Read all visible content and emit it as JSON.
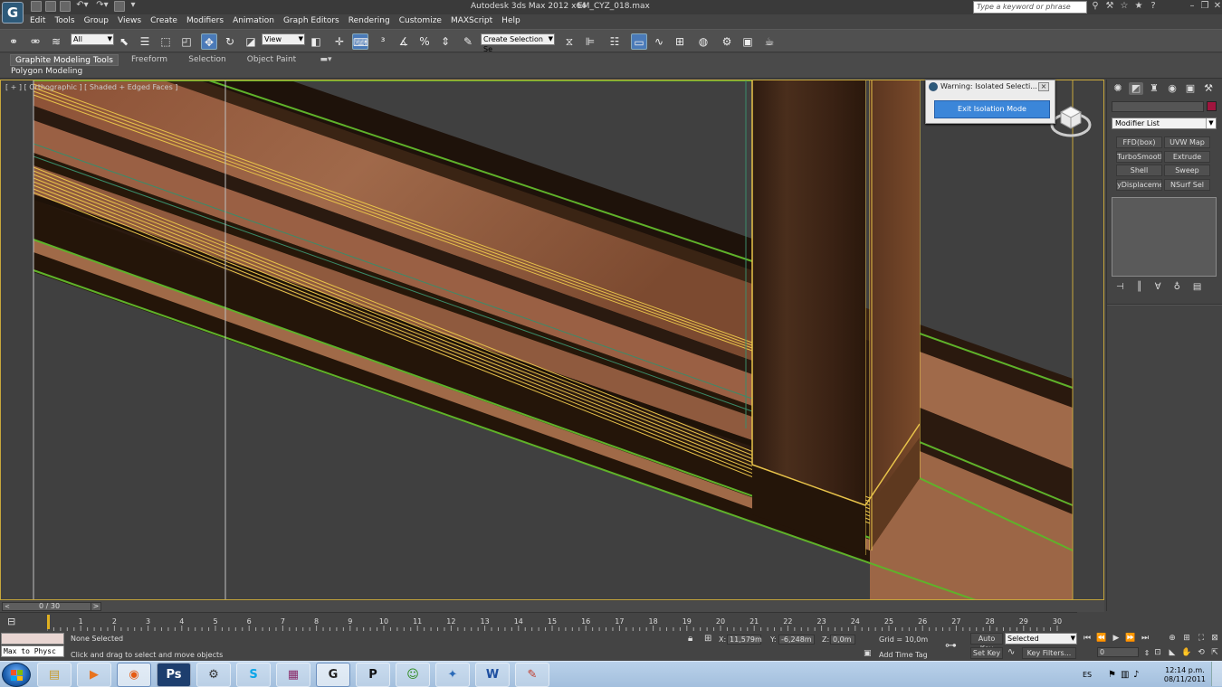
{
  "titlebar": {
    "app_title": "Autodesk 3ds Max  2012 x64",
    "file_name": "EM_CYZ_018.max",
    "search_placeholder": "Type a keyword or phrase",
    "logo_letter": "G"
  },
  "menu": [
    "Edit",
    "Tools",
    "Group",
    "Views",
    "Create",
    "Modifiers",
    "Animation",
    "Graph Editors",
    "Rendering",
    "Customize",
    "MAXScript",
    "Help"
  ],
  "toolbar": {
    "selection_filter": "All",
    "reference_coord": "View",
    "named_selection": "Create Selection Se"
  },
  "ribbon": {
    "tabs": [
      "Graphite Modeling Tools",
      "Freeform",
      "Selection",
      "Object Paint"
    ],
    "active_tab": "Graphite Modeling Tools",
    "sub_tab": "Polygon Modeling"
  },
  "viewport": {
    "label": "[ + ] [ Orthographic ] [ Shaded + Edged Faces ]"
  },
  "warning": {
    "title": "Warning: Isolated Selecti...",
    "close": "⨯",
    "button": "Exit Isolation Mode"
  },
  "command_panel": {
    "object_color": "#a0153e",
    "modifier_list": "Modifier List",
    "modifier_buttons": [
      "FFD(box)",
      "UVW Map",
      "TurboSmooth",
      "Extrude",
      "Shell",
      "Sweep",
      "yDisplacement",
      "NSurf Sel"
    ]
  },
  "timeline": {
    "frame_display": "0 / 30",
    "ticks": [
      "1",
      "2",
      "3",
      "4",
      "5",
      "6",
      "7",
      "8",
      "9",
      "10",
      "11",
      "12",
      "13",
      "14",
      "15",
      "16",
      "17",
      "18",
      "19",
      "20",
      "21",
      "22",
      "23",
      "24",
      "25",
      "26",
      "27",
      "28",
      "29",
      "30"
    ]
  },
  "status": {
    "maxscript_line": "Max to Physc",
    "selection_status": "None Selected",
    "prompt": "Click and drag to select and move objects",
    "x_label": "X:",
    "x_value": "11,579m",
    "y_label": "Y:",
    "y_value": "-6,248m",
    "z_label": "Z:",
    "z_value": "0,0m",
    "grid": "Grid = 10,0m",
    "add_time_tag": "Add Time Tag",
    "auto_key": "Auto Key",
    "auto_key_mode": "Selected",
    "set_key": "Set Key",
    "key_filters": "Key Filters...",
    "current_frame": "0"
  },
  "taskbar": {
    "language": "ES",
    "time": "12:14 p.m.",
    "date": "08/11/2011",
    "apps": [
      "explorer",
      "media-player",
      "firefox",
      "photoshop",
      "network",
      "skype",
      "winrar",
      "3dsmax",
      "pixel",
      "messenger",
      "games",
      "word",
      "paint"
    ]
  },
  "icons": {
    "undo": "undo-icon",
    "select": "select-icon",
    "move": "move-icon",
    "rotate": "rotate-icon"
  }
}
